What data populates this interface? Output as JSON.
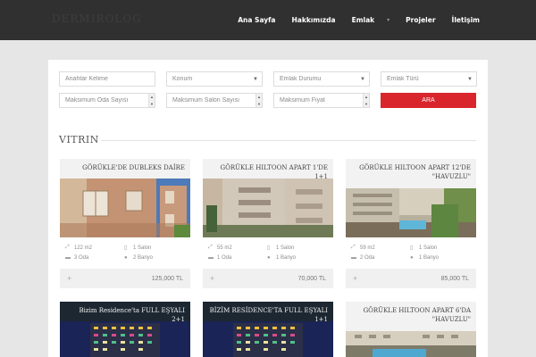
{
  "header": {
    "logo": "DERMIROLOG",
    "nav": [
      {
        "label": "Ana Sayfa"
      },
      {
        "label": "Hakkımızda"
      },
      {
        "label": "Emlak"
      },
      {
        "label": "Projeler"
      },
      {
        "label": "İletişim"
      }
    ]
  },
  "search": {
    "keyword_placeholder": "Anahtar Kelime",
    "location": "Konum",
    "status": "Emlak Durumu",
    "type": "Emlak Türü",
    "max_rooms_placeholder": "Maksimum Oda Sayısı",
    "max_salons_placeholder": "Maksimum Salon Sayısı",
    "max_price_placeholder": "Maksimum Fiyat",
    "submit_label": "ARA"
  },
  "section": {
    "title": "VITRIN"
  },
  "listings": [
    {
      "title": "GÖRÜKLE'DE DUBLEKS DAİRE",
      "area": "122 m2",
      "salon": "1 Salon",
      "rooms": "3 Oda",
      "bath": "2 Banyo",
      "price": "125,000 TL"
    },
    {
      "title": "GÖRÜKLE HILTOON APART 1'DE 1+1",
      "area": "55 m2",
      "salon": "1 Salon",
      "rooms": "1 Oda",
      "bath": "1 Banyo",
      "price": "70,000 TL"
    },
    {
      "title": "GÖRÜKLE HILTOON APART 12'DE \"HAVUZLU\"",
      "area": "59 m2",
      "salon": "1 Salon",
      "rooms": "2 Oda",
      "bath": "1 Banyo",
      "price": "85,000 TL"
    },
    {
      "title": "Bizim Residence'ta FULL EŞYALI 2+1"
    },
    {
      "title": "BİZİM RESİDENCE'TA FULL EŞYALI 1+1"
    },
    {
      "title": "GÖRÜKLE HILTOON APART 6'DA \"HAVUZLU\""
    }
  ],
  "colors": {
    "topbar": "#303030",
    "accent": "#d9262c",
    "background": "#e6e6e6"
  }
}
